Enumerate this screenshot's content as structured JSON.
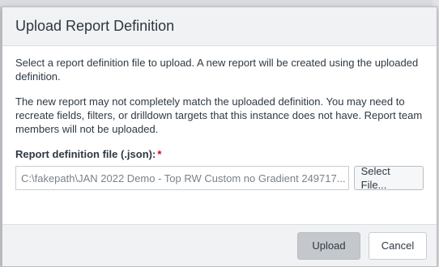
{
  "dialog": {
    "title": "Upload Report Definition",
    "intro": "Select a report definition file to upload. A new report will be created using the uploaded definition.",
    "warning": "The new report may not completely match the uploaded definition. You may need to recreate fields, filters, or drilldown targets that this instance does not have. Report team members will not be uploaded.",
    "field_label": "Report definition file (.json):",
    "required_marker": "*",
    "file_value": "C:\\fakepath\\JAN 2022 Demo - Top RW Custom no Gradient 249717...",
    "select_file_label": "Select File...",
    "upload_label": "Upload",
    "cancel_label": "Cancel"
  },
  "colors": {
    "required": "#d0021b",
    "header_bg": "#f1f2f3",
    "upload_bg": "#c4c8cc"
  }
}
